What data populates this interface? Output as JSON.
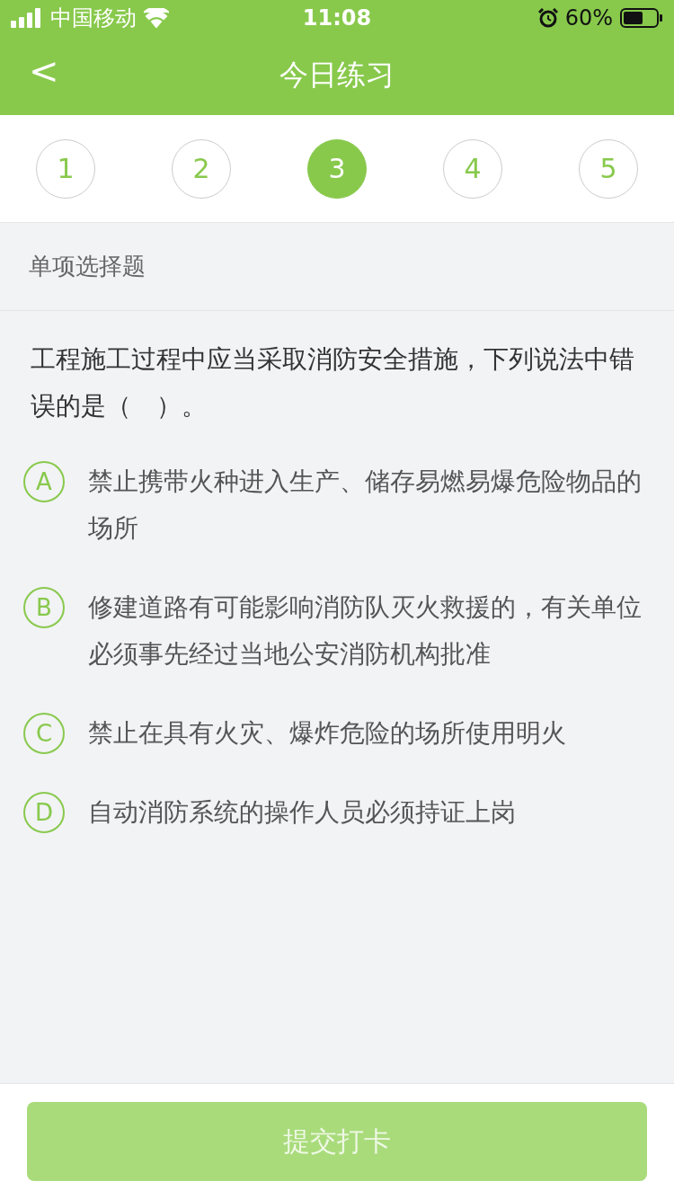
{
  "status_bar": {
    "carrier": "中国移动",
    "time": "11:08",
    "battery_text": "60%"
  },
  "nav": {
    "back": "<",
    "title": "今日练习"
  },
  "steps": [
    {
      "label": "1",
      "selected": false
    },
    {
      "label": "2",
      "selected": false
    },
    {
      "label": "3",
      "selected": true
    },
    {
      "label": "4",
      "selected": false
    },
    {
      "label": "5",
      "selected": false
    }
  ],
  "question": {
    "type_label": "单项选择题",
    "text": "工程施工过程中应当采取消防安全措施，下列说法中错误的是（　）。",
    "options": [
      {
        "letter": "A",
        "text": "禁止携带火种进入生产、储存易燃易爆危险物品的场所",
        "selected": false
      },
      {
        "letter": "B",
        "text": "修建道路有可能影响消防队灭火救援的，有关单位必须事先经过当地公安消防机构批准",
        "selected": false
      },
      {
        "letter": "C",
        "text": "禁止在具有火灾、爆炸危险的场所使用明火",
        "selected": false
      },
      {
        "letter": "D",
        "text": "自动消防系统的操作人员必须持证上岗",
        "selected": false
      }
    ]
  },
  "submit": {
    "label": "提交打卡",
    "disabled": true
  }
}
